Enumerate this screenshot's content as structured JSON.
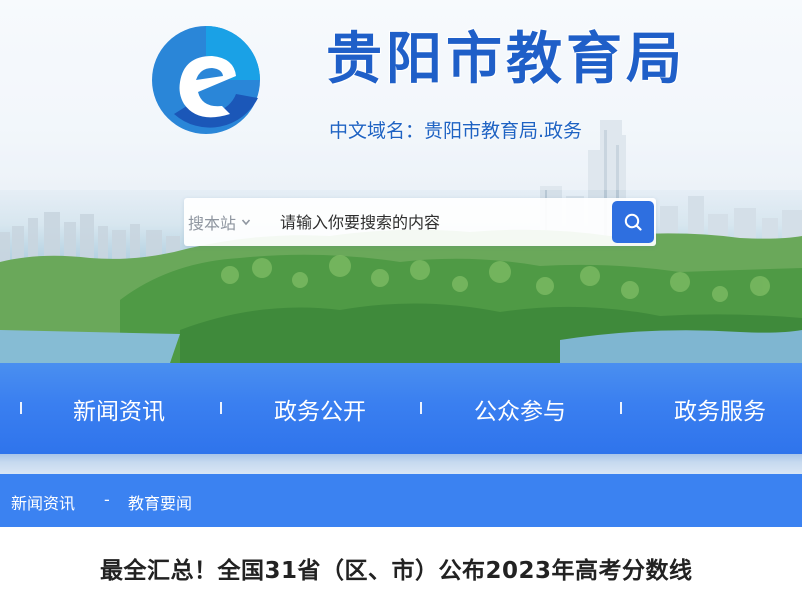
{
  "header": {
    "title": "贵阳市教育局",
    "domain_line": "中文域名：贵阳市教育局.政务",
    "logo_icon": "e-logo-icon"
  },
  "search": {
    "scope_label": "搜本站",
    "placeholder": "请输入你要搜索的内容",
    "button_icon": "search-icon"
  },
  "nav": {
    "items": [
      {
        "label": "新闻资讯"
      },
      {
        "label": "政务公开"
      },
      {
        "label": "公众参与"
      },
      {
        "label": "政务服务"
      }
    ]
  },
  "breadcrumb": {
    "items": [
      {
        "label": "新闻资讯"
      },
      {
        "label": "教育要闻"
      }
    ],
    "separator": "-"
  },
  "article": {
    "title": "最全汇总！全国31省（区、市）公布2023年高考分数线"
  },
  "colors": {
    "brand_blue": "#1f5fc8",
    "nav_blue": "#3a7ff0",
    "search_button": "#2e6fe0"
  }
}
